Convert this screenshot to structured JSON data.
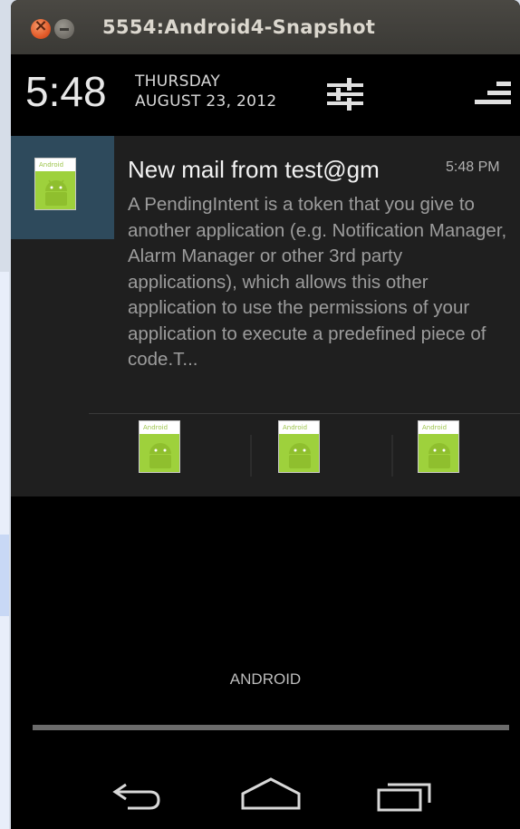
{
  "window": {
    "title": "5554:Android4-Snapshot"
  },
  "status_header": {
    "time": "5:48",
    "day": "THURSDAY",
    "date": "AUGUST 23, 2012"
  },
  "notification": {
    "title": "New mail from test@gm",
    "time": "5:48 PM",
    "body": "A PendingIntent is a token that you give to another application (e.g. Notification Manager, Alarm Manager or other 3rd party applications), which allows this other application to use the permissions of your application to execute a predefined piece of code.T...",
    "icon_tag": "Android",
    "actions": [
      {
        "icon_tag": "Android"
      },
      {
        "icon_tag": "Android"
      },
      {
        "icon_tag": "Android"
      }
    ]
  },
  "carrier": "ANDROID",
  "colors": {
    "titlebar": "#3e3d39",
    "notification_bg": "#1f1f1f",
    "icon_highlight": "#2e4a5c",
    "android_green": "#9ed13c"
  },
  "icons": {
    "close": "close-icon",
    "minimize": "minimize-icon",
    "settings": "quick-settings-icon",
    "clear": "clear-notifications-icon",
    "back": "back-icon",
    "home": "home-icon",
    "recents": "recent-apps-icon"
  }
}
